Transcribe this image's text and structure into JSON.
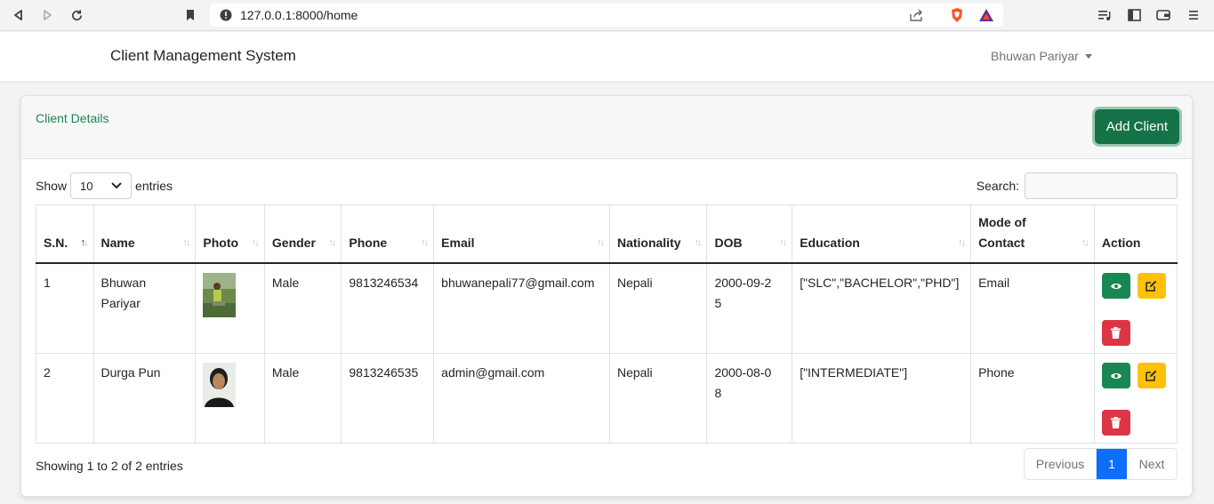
{
  "browser": {
    "url": "127.0.0.1:8000/home"
  },
  "navbar": {
    "brand": "Client Management System",
    "user": "Bhuwan Pariyar"
  },
  "card": {
    "title": "Client Details",
    "add_button": "Add Client"
  },
  "controls": {
    "show_label": "Show",
    "entries_value": "10",
    "entries_label": "entries",
    "search_label": "Search:"
  },
  "table": {
    "headers": [
      "S.N.",
      "Name",
      "Photo",
      "Gender",
      "Phone",
      "Email",
      "Nationality",
      "DOB",
      "Education",
      "Mode of Contact",
      "Action"
    ],
    "rows": [
      {
        "sn": "1",
        "name": "Bhuwan Pariyar",
        "gender": "Male",
        "phone": "9813246534",
        "email": "bhuwanepali77@gmail.com",
        "nationality": "Nepali",
        "dob": "2000-09-25",
        "education": "[\"SLC\",\"BACHELOR\",\"PHD\"]",
        "contact": "Email"
      },
      {
        "sn": "2",
        "name": "Durga Pun",
        "gender": "Male",
        "phone": "9813246535",
        "email": "admin@gmail.com",
        "nationality": "Nepali",
        "dob": "2000-08-08",
        "education": "[\"INTERMEDIATE\"]",
        "contact": "Phone"
      }
    ]
  },
  "footer": {
    "info": "Showing 1 to 2 of 2 entries",
    "previous": "Previous",
    "page": "1",
    "next": "Next"
  },
  "colors": {
    "primary_green": "#198754",
    "warning": "#ffc107",
    "danger": "#dc3545",
    "page_active": "#0d6efd"
  }
}
